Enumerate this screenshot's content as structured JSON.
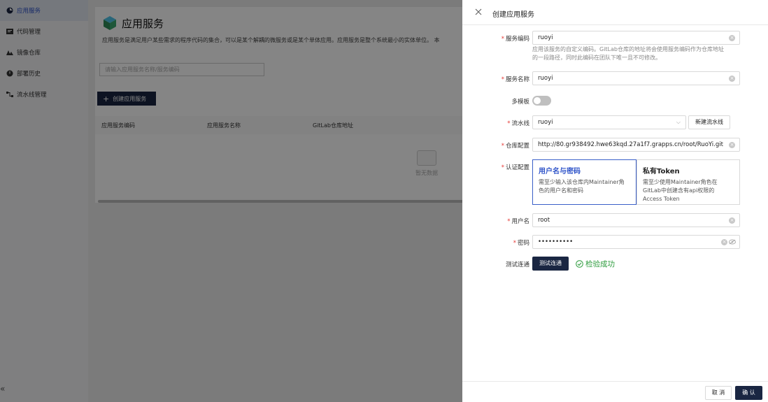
{
  "sidebar": {
    "items": [
      {
        "label": "应用服务",
        "icon": "app-service-icon",
        "active": true
      },
      {
        "label": "代码管理",
        "icon": "code-icon",
        "active": false
      },
      {
        "label": "镜像仓库",
        "icon": "image-repo-icon",
        "active": false
      },
      {
        "label": "部署历史",
        "icon": "deploy-history-icon",
        "active": false
      },
      {
        "label": "流水线管理",
        "icon": "pipeline-icon",
        "active": false
      }
    ],
    "collapse_glyph": "«"
  },
  "page": {
    "title": "应用服务",
    "description": "应用服务是满足用户某些需求的程序代码的集合，可以是某个解耦的微服务或是某个单体应用。应用服务是整个系统最小的实体单位。 本",
    "search_placeholder": "请输入应用服务名称/服务编码",
    "create_button": "创建应用服务",
    "table_headers": [
      "应用服务编码",
      "应用服务名称",
      "GitLab仓库地址"
    ],
    "empty_text": "暂无数据"
  },
  "drawer": {
    "title": "创建应用服务",
    "service_code": {
      "label": "服务编码",
      "value": "ruoyi",
      "hint_line1": "应用该服务的自定义编码。GitLab仓库的地址将会使用服务编码作为仓库地址",
      "hint_line2": "的一段路径，同时此编码在团队下唯一且不可修改。"
    },
    "service_name": {
      "label": "服务名称",
      "value": "ruoyi"
    },
    "multi_template": {
      "label": "多模板",
      "on": false
    },
    "pipeline": {
      "label": "流水线",
      "value": "ruoyi",
      "new_button": "新建流水线"
    },
    "repo": {
      "label": "仓库配置",
      "value": "http://80.gr938492.hwe63kqd.27a1f7.grapps.cn/root/RuoYi.git"
    },
    "auth": {
      "label": "认证配置",
      "options": [
        {
          "title": "用户名与密码",
          "desc_line1": "需至少输入该仓库内Maintainer角",
          "desc_line2": "色的用户名和密码",
          "desc_line3": "",
          "selected": true
        },
        {
          "title": "私有Token",
          "desc_line1": "需至少使用Maintainer角色在",
          "desc_line2": "GitLab中创建含有api权限的",
          "desc_line3": "Access Token",
          "selected": false
        }
      ]
    },
    "username": {
      "label": "用户名",
      "value": "root"
    },
    "password": {
      "label": "密码",
      "value": "••••••••••"
    },
    "test": {
      "label": "测试连通",
      "button": "测试连通",
      "result": "检验成功"
    },
    "footer": {
      "cancel": "取 消",
      "confirm": "确 认"
    }
  },
  "colors": {
    "accent": "#2f54c9",
    "dark_button": "#1a2642",
    "success": "#2e9c3e",
    "required": "#e53935"
  }
}
